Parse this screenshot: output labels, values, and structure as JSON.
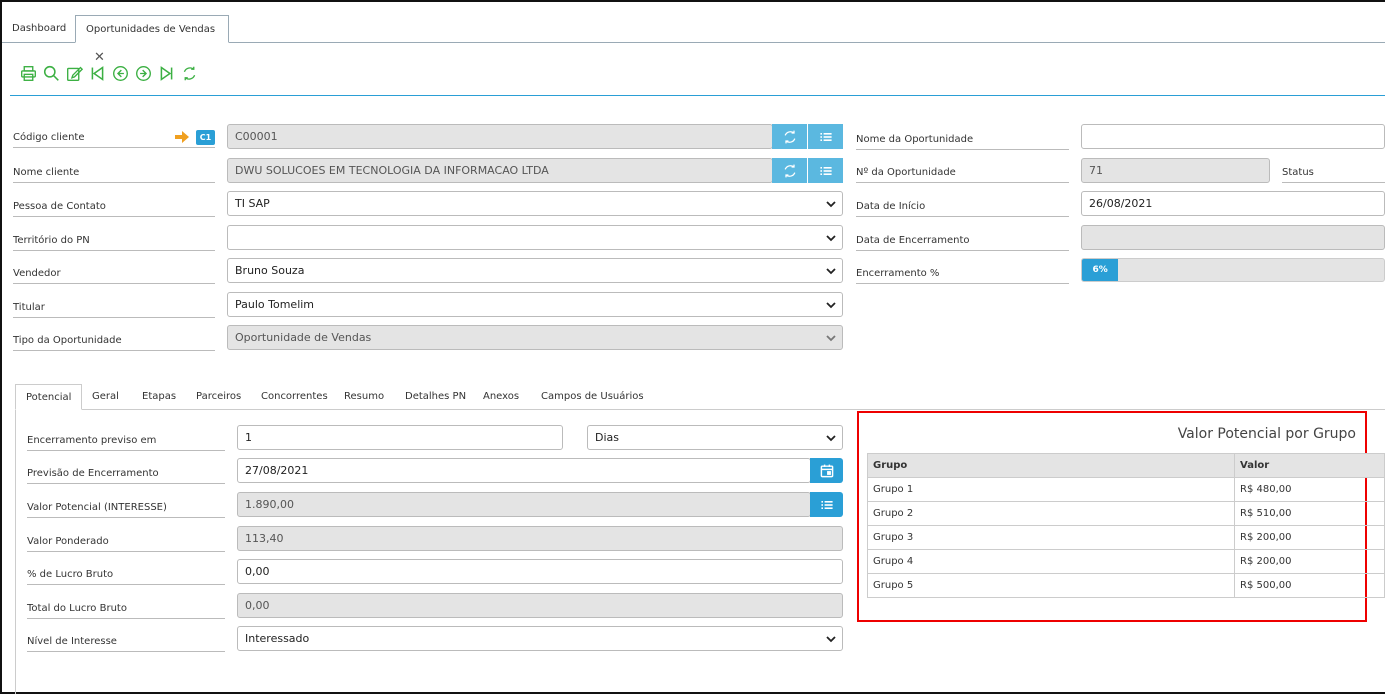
{
  "tabs": [
    {
      "label": "Dashboard"
    },
    {
      "label": "Oportunidades de Vendas"
    }
  ],
  "toolbar": {
    "icons": [
      "print-icon",
      "search-icon",
      "edit-icon",
      "first-record-icon",
      "previous-record-icon",
      "next-record-icon",
      "last-record-icon",
      "refresh-icon"
    ],
    "color": "#3cb043"
  },
  "left_form": {
    "codigo_cliente": {
      "label": "Código cliente",
      "badge": "C1",
      "value": "C00001"
    },
    "nome_cliente": {
      "label": "Nome cliente",
      "value": "DWU SOLUCOES EM TECNOLOGIA DA INFORMACAO LTDA"
    },
    "pessoa_contato": {
      "label": "Pessoa de Contato",
      "value": "TI SAP"
    },
    "territorio": {
      "label": "Território do PN",
      "value": ""
    },
    "vendedor": {
      "label": "Vendedor",
      "value": "Bruno Souza"
    },
    "titular": {
      "label": "Titular",
      "value": "Paulo Tomelim"
    },
    "tipo": {
      "label": "Tipo da Oportunidade",
      "value": "Oportunidade de Vendas"
    }
  },
  "right_form": {
    "nome_oportunidade": {
      "label": "Nome da Oportunidade",
      "value": ""
    },
    "numero": {
      "label": "Nº da Oportunidade",
      "value": "71"
    },
    "status": {
      "label": "Status"
    },
    "data_inicio": {
      "label": "Data de Início",
      "value": "26/08/2021"
    },
    "data_encerramento": {
      "label": "Data de Encerramento",
      "value": ""
    },
    "encerramento_pct": {
      "label": "Encerramento %",
      "value": "6%",
      "fraction": 0.06
    }
  },
  "subtabs": [
    "Potencial",
    "Geral",
    "Etapas",
    "Parceiros",
    "Concorrentes",
    "Resumo",
    "Detalhes PN",
    "Anexos",
    "Campos de Usuários"
  ],
  "potencial": {
    "encerramento_previsto": {
      "label": "Encerramento previso em",
      "value": "1",
      "unit": "Dias"
    },
    "previsao": {
      "label": "Previsão de Encerramento",
      "value": "27/08/2021"
    },
    "valor_potencial": {
      "label": "Valor Potencial (INTERESSE)",
      "value": "1.890,00"
    },
    "valor_ponderado": {
      "label": "Valor Ponderado",
      "value": "113,40"
    },
    "lucro_pct": {
      "label": "% de Lucro Bruto",
      "value": "0,00"
    },
    "total_lucro": {
      "label": "Total do Lucro Bruto",
      "value": "0,00"
    },
    "nivel_interesse": {
      "label": "Nível de Interesse",
      "value": "Interessado"
    }
  },
  "grupo_table": {
    "title": "Valor Potencial por Grupo",
    "headers": [
      "Grupo",
      "Valor"
    ],
    "rows": [
      [
        "Grupo 1",
        "R$ 480,00"
      ],
      [
        "Grupo 2",
        "R$ 510,00"
      ],
      [
        "Grupo 3",
        "R$ 200,00"
      ],
      [
        "Grupo 4",
        "R$ 200,00"
      ],
      [
        "Grupo 5",
        "R$ 500,00"
      ]
    ]
  },
  "colors": {
    "accent": "#2a9fd6",
    "highlight_box": "#e00000",
    "toolbar_green": "#3cb043"
  }
}
